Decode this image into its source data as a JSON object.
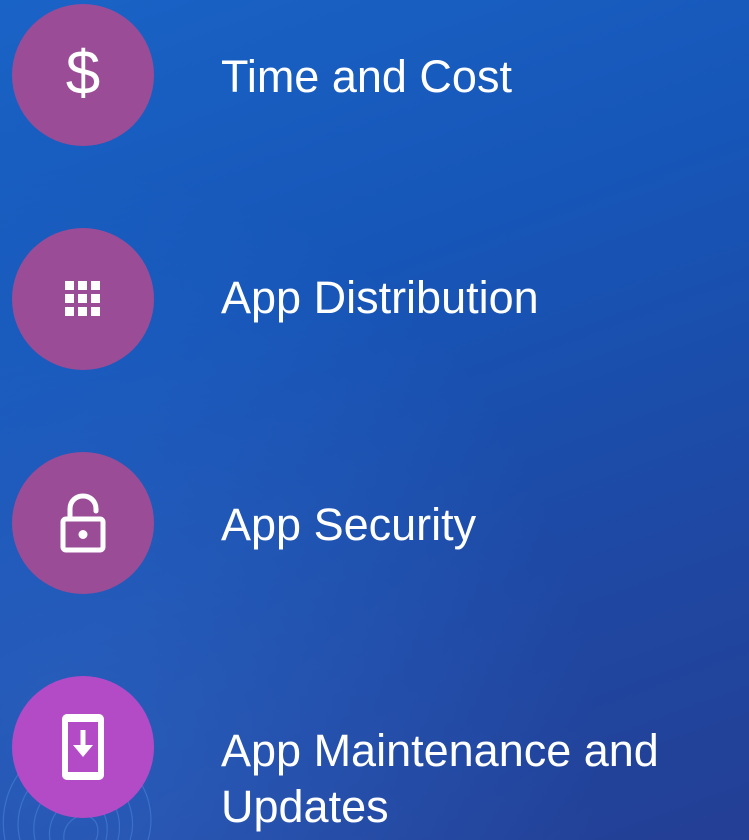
{
  "colors": {
    "circle_muted": "#9a4c97",
    "circle_bright": "#b34ac6",
    "text": "#ffffff"
  },
  "items": [
    {
      "label": "Time and Cost",
      "icon": "dollar-icon",
      "glyph": "$"
    },
    {
      "label": "App Distribution",
      "icon": "app-grid-icon"
    },
    {
      "label": "App Security",
      "icon": "unlocked-padlock-icon"
    },
    {
      "label": "App Maintenance and",
      "label_line2": "Updates",
      "icon": "phone-download-icon"
    }
  ]
}
